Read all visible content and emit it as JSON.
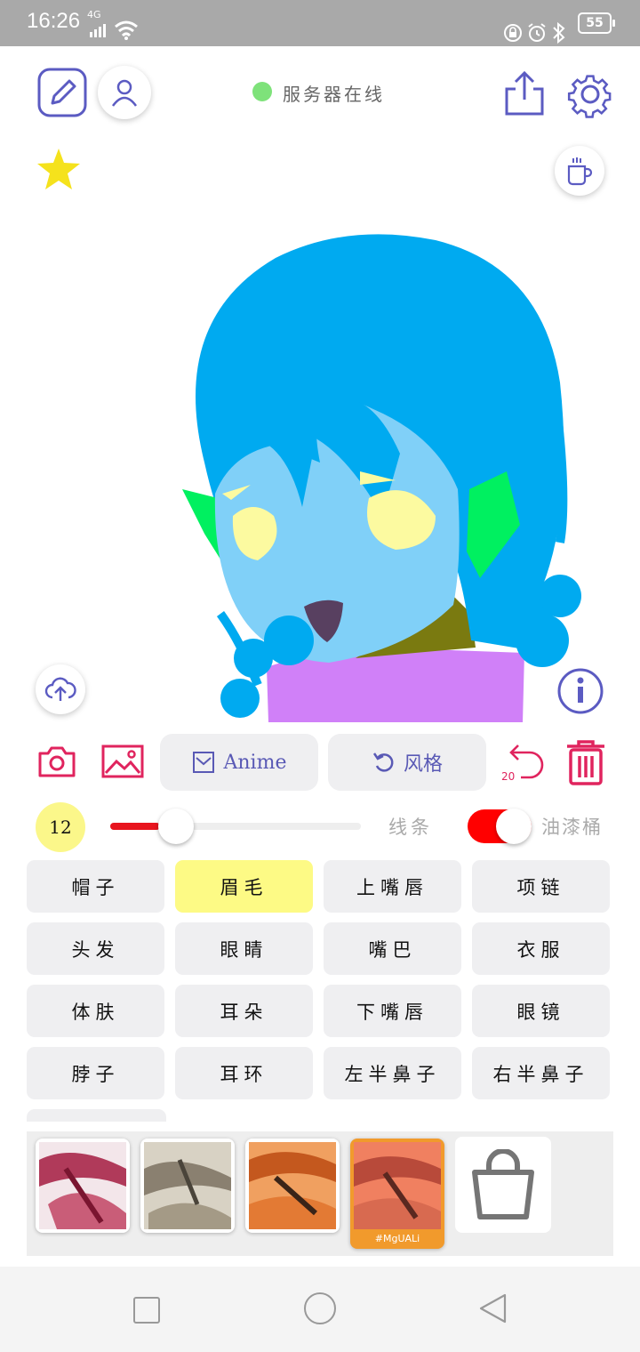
{
  "status_bar": {
    "time": "16:26",
    "network": "4G",
    "battery": "55"
  },
  "header": {
    "server_status": "服务器在线",
    "server_status_color": "#7ee27a"
  },
  "toolbar": {
    "anime_label": "Anime",
    "style_label": "风格",
    "undo_count": "20"
  },
  "brush": {
    "size": "12",
    "slider_value_percent": 20,
    "line_label": "线条",
    "bucket_label": "油漆桶",
    "bucket_on": true
  },
  "parts": [
    [
      "帽子",
      "眉毛",
      "上嘴唇",
      "项链"
    ],
    [
      "头发",
      "眼睛",
      "嘴巴",
      "衣服"
    ],
    [
      "体肤",
      "耳朵",
      "下嘴唇",
      "眼镜"
    ],
    [
      "脖子",
      "耳环",
      "左半鼻子",
      "右半鼻子"
    ]
  ],
  "selected_part": "眉毛",
  "gallery": {
    "selected_caption": "#MgUALi"
  },
  "colors": {
    "accent": "#5b5bc2",
    "danger": "#e0245e",
    "star": "#f5e21c",
    "hair": "#00aaf0",
    "skin": "#80d0f8",
    "eyes": "#fcfaa0",
    "ear": "#00f060",
    "shirt": "#d080f8",
    "mouth": "#584060",
    "neck": "#7a7a10"
  }
}
